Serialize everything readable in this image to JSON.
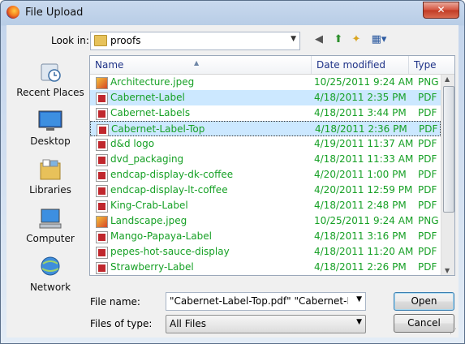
{
  "window": {
    "title": "File Upload",
    "close_label": "✕"
  },
  "lookin": {
    "label": "Look in:",
    "folder": "proofs"
  },
  "places": [
    {
      "label": "Recent Places",
      "icon": "recent-places-icon"
    },
    {
      "label": "Desktop",
      "icon": "desktop-icon"
    },
    {
      "label": "Libraries",
      "icon": "libraries-icon"
    },
    {
      "label": "Computer",
      "icon": "computer-icon"
    },
    {
      "label": "Network",
      "icon": "network-icon"
    }
  ],
  "columns": {
    "name": "Name",
    "date": "Date modified",
    "type": "Type"
  },
  "files": [
    {
      "name": "Architecture.jpeg",
      "date": "10/25/2011 9:24 AM",
      "type": "PNG in",
      "kind": "png"
    },
    {
      "name": "Cabernet-Label",
      "date": "4/18/2011 2:35 PM",
      "type": "PDF Fil",
      "kind": "pdf",
      "selected": true
    },
    {
      "name": "Cabernet-Labels",
      "date": "4/18/2011 3:44 PM",
      "type": "PDF Fil",
      "kind": "pdf"
    },
    {
      "name": "Cabernet-Label-Top",
      "date": "4/18/2011 2:36 PM",
      "type": "PDF Fil",
      "kind": "pdf",
      "selected": true,
      "focused": true
    },
    {
      "name": "d&d logo",
      "date": "4/19/2011 11:37 AM",
      "type": "PDF Fil",
      "kind": "pdf"
    },
    {
      "name": "dvd_packaging",
      "date": "4/18/2011 11:33 AM",
      "type": "PDF Fil",
      "kind": "pdf"
    },
    {
      "name": "endcap-display-dk-coffee",
      "date": "4/20/2011 1:00 PM",
      "type": "PDF Fil",
      "kind": "pdf"
    },
    {
      "name": "endcap-display-lt-coffee",
      "date": "4/20/2011 12:59 PM",
      "type": "PDF Fil",
      "kind": "pdf"
    },
    {
      "name": "King-Crab-Label",
      "date": "4/18/2011 2:48 PM",
      "type": "PDF Fil",
      "kind": "pdf"
    },
    {
      "name": "Landscape.jpeg",
      "date": "10/25/2011 9:24 AM",
      "type": "PNG in",
      "kind": "png"
    },
    {
      "name": "Mango-Papaya-Label",
      "date": "4/18/2011 3:16 PM",
      "type": "PDF Fil",
      "kind": "pdf"
    },
    {
      "name": "pepes-hot-sauce-display",
      "date": "4/18/2011 11:20 AM",
      "type": "PDF Fil",
      "kind": "pdf"
    },
    {
      "name": "Strawberry-Label",
      "date": "4/18/2011 2:26 PM",
      "type": "PDF Fil",
      "kind": "pdf"
    }
  ],
  "filename": {
    "label": "File name:",
    "value": "\"Cabernet-Label-Top.pdf\" \"Cabernet-Label.pdf\""
  },
  "filetype": {
    "label": "Files of type:",
    "value": "All Files"
  },
  "buttons": {
    "open": "Open",
    "cancel": "Cancel"
  },
  "colors": {
    "file_text": "#16a025",
    "selection": "#cce8ff",
    "header_text": "#1e3287"
  }
}
